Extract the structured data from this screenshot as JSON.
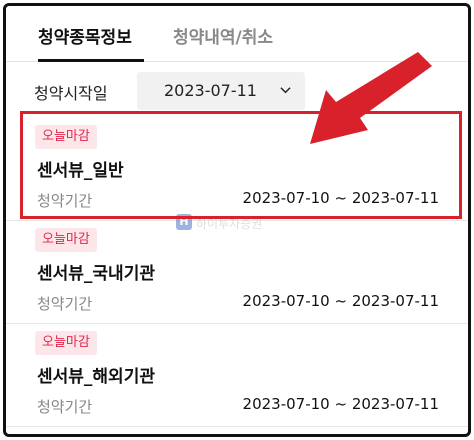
{
  "tabs": [
    {
      "label": "청약종목정보",
      "active": true
    },
    {
      "label": "청약내역/취소",
      "active": false
    }
  ],
  "filter": {
    "label": "청약시작일",
    "date_value": "2023-07-11"
  },
  "items": [
    {
      "badge": "오늘마감",
      "name": "센서뷰_일반",
      "period_label": "청약기간",
      "period_value": "2023-07-10 ~ 2023-07-11"
    },
    {
      "badge": "오늘마감",
      "name": "센서뷰_국내기관",
      "period_label": "청약기간",
      "period_value": "2023-07-10 ~ 2023-07-11"
    },
    {
      "badge": "오늘마감",
      "name": "센서뷰_해외기관",
      "period_label": "청약기간",
      "period_value": "2023-07-10 ~ 2023-07-11"
    }
  ],
  "watermark": {
    "logo": "H",
    "text": "하이투자증권"
  },
  "colors": {
    "badge_text": "#e4264d",
    "badge_bg": "#fde6ea",
    "highlight": "#d9212c"
  }
}
